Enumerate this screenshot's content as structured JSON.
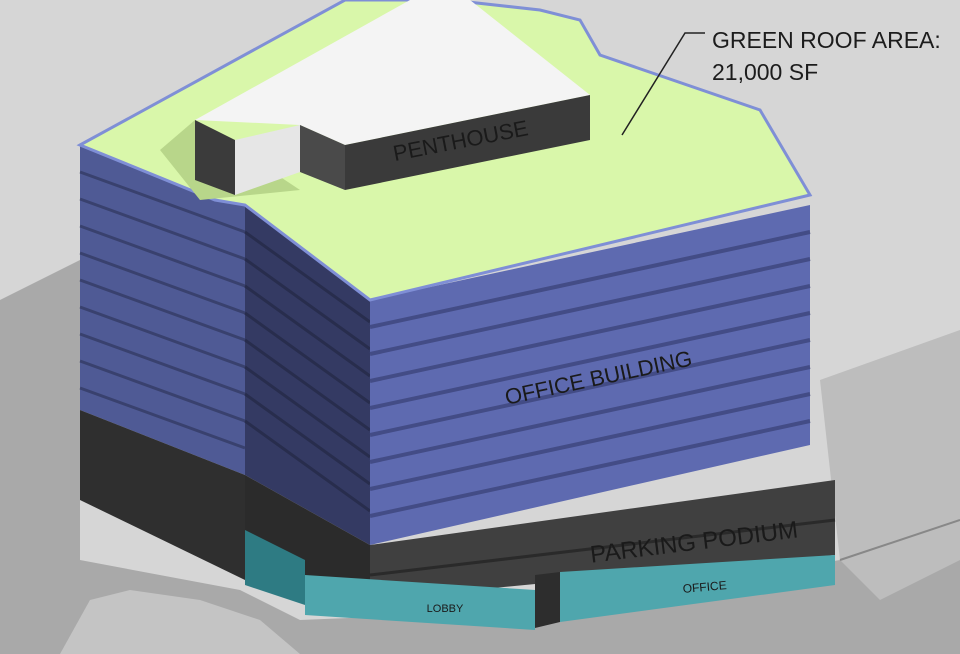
{
  "callout": {
    "title": "GREEN ROOF AREA:",
    "area": "21,000 SF"
  },
  "labels": {
    "penthouse": "PENTHOUSE",
    "office_building": "OFFICE BUILDING",
    "parking_podium": "PARKING PODIUM",
    "lobby": "LOBBY",
    "office": "OFFICE"
  },
  "colors": {
    "background": "#d6d6d6",
    "ground_shadow": "#a8a8a8",
    "green_roof": "#d8f7a8",
    "glass_facade": "#5a67a8",
    "glass_dark": "#39416f",
    "podium": "#3c3c3c",
    "ground_floor_glass": "#4aa9b0",
    "penthouse_top": "#f4f4f4",
    "penthouse_side": "#3a3a3a"
  }
}
